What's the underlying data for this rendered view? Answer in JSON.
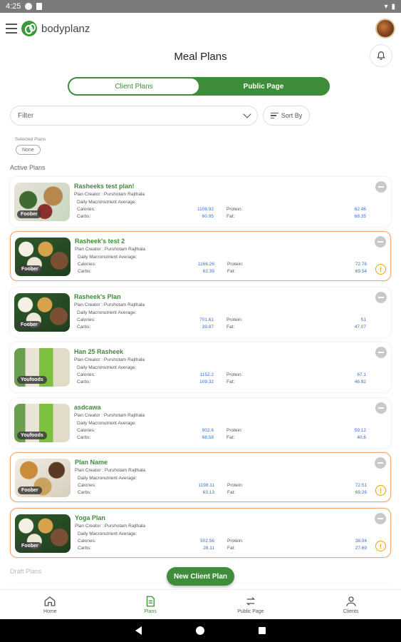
{
  "status_bar": {
    "time": "4:25"
  },
  "app": {
    "brand": "bodyplanz"
  },
  "header": {
    "title": "Meal Plans"
  },
  "tabs": [
    {
      "label": "Client Plans",
      "active": true
    },
    {
      "label": "Public Page",
      "active": false
    }
  ],
  "filter": {
    "placeholder": "Filter",
    "sort_label": "Sort By"
  },
  "selected_plans": {
    "label": "Selected Plans",
    "value": "None"
  },
  "sections": {
    "active": "Active Plans",
    "draft": "Draft Plans"
  },
  "macro_labels": {
    "heading": "Daily Macronutrient Average:",
    "calories": "Calories:",
    "carbs": "Carbs:",
    "protein": "Protein:",
    "fat": "Fat:"
  },
  "plans": [
    {
      "title": "Rasheeks test plan!",
      "creator": "Plan Creator : Purshotam Rajthala",
      "badge": "Foober",
      "calories": "1108.92",
      "carbs": "60.95",
      "protein": "62.46",
      "fat": "68.35",
      "warning": false
    },
    {
      "title": "Rasheek's test 2",
      "creator": "Plan Creator : Purshotam Rajthala",
      "badge": "Foober",
      "calories": "1166.26",
      "carbs": "62.39",
      "protein": "72.76",
      "fat": "69.54",
      "warning": true
    },
    {
      "title": "Rasheek's Plan",
      "creator": "Plan Creator : Purshotam Rajthala",
      "badge": "Foober",
      "calories": "701.61",
      "carbs": "39.87",
      "protein": "51",
      "fat": "47.07",
      "warning": false
    },
    {
      "title": "Han 25 Rasheek",
      "creator": "Plan Creator : Purshotam Rajthala",
      "badge": "Youfoods",
      "calories": "1152.2",
      "carbs": "109.32",
      "protein": "67.1",
      "fat": "46.92",
      "warning": false
    },
    {
      "title": "asdcawa",
      "creator": "Plan Creator : Purshotam Rajthala",
      "badge": "Youfoods",
      "calories": "902.6",
      "carbs": "68.58",
      "protein": "59.12",
      "fat": "40.6",
      "warning": false
    },
    {
      "title": "Plan Name",
      "creator": "Plan Creator : Purshotam Rajthala",
      "badge": "Foober",
      "calories": "1198.11",
      "carbs": "63.13",
      "protein": "72.51",
      "fat": "69.26",
      "warning": true
    },
    {
      "title": "Yoga Plan",
      "creator": "Plan Creator : Purshotam Rajthala",
      "badge": "Foober",
      "calories": "502.56",
      "carbs": "28.11",
      "protein": "38.04",
      "fat": "27.69",
      "warning": true
    }
  ],
  "fab_label": "New Client Plan",
  "bottom_nav": [
    {
      "label": "Home",
      "icon": "home-icon"
    },
    {
      "label": "Plans",
      "icon": "plans-icon"
    },
    {
      "label": "Public Page",
      "icon": "swap-icon"
    },
    {
      "label": "Clients",
      "icon": "person-icon"
    }
  ],
  "colors": {
    "brand_green": "#3f8d3a",
    "value_blue": "#3a6fd0",
    "warning_orange": "#f0a000"
  }
}
